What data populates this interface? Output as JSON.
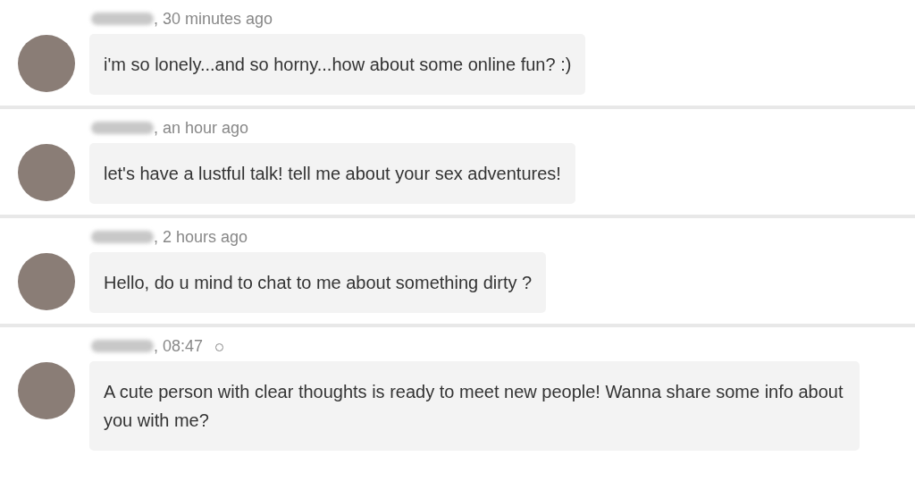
{
  "messages": [
    {
      "time": ", 30 minutes ago",
      "text": "i'm so lonely...and so horny...how about some online fun? :)",
      "unread": false
    },
    {
      "time": ", an hour ago",
      "text": "let's have a lustful talk! tell me about your sex adventures!",
      "unread": false
    },
    {
      "time": ", 2 hours ago",
      "text": "Hello, do u mind to chat to me about something dirty ?",
      "unread": false
    },
    {
      "time": ", 08:47",
      "text": "A cute person with clear thoughts is ready to meet new people! Wanna share some info about you with me?",
      "unread": true
    }
  ]
}
